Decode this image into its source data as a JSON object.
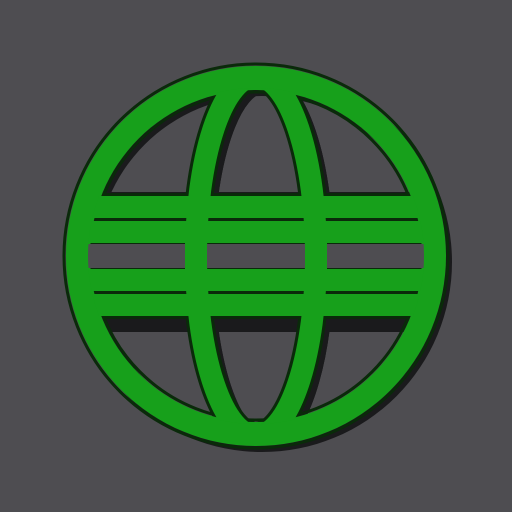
{
  "app_icon": {
    "icon": "globe-icon",
    "colors": {
      "background": "#4e4d51",
      "globe_fill": "#17a01b",
      "globe_outline": "#0a2a0a",
      "shadow": "#1a1a1c"
    }
  }
}
